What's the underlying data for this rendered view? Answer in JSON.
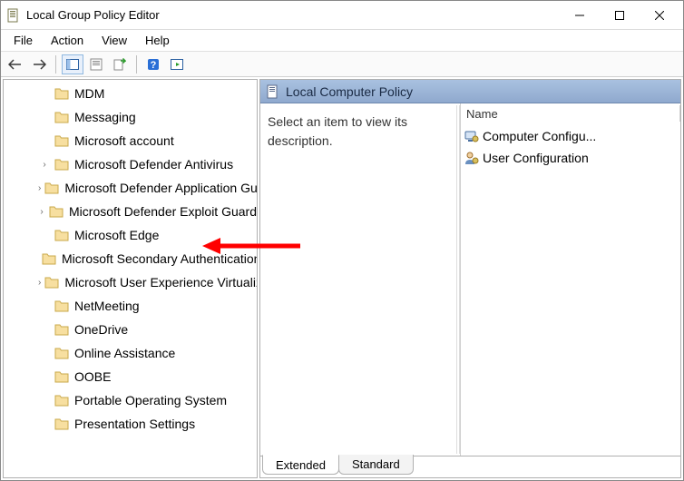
{
  "window": {
    "title": "Local Group Policy Editor",
    "icon": "policy-doc-icon"
  },
  "menubar": [
    "File",
    "Action",
    "View",
    "Help"
  ],
  "tree": {
    "items": [
      {
        "label": "MDM",
        "expandable": false
      },
      {
        "label": "Messaging",
        "expandable": false
      },
      {
        "label": "Microsoft account",
        "expandable": false
      },
      {
        "label": "Microsoft Defender Antivirus",
        "expandable": true
      },
      {
        "label": "Microsoft Defender Application Guard",
        "expandable": true
      },
      {
        "label": "Microsoft Defender Exploit Guard",
        "expandable": true
      },
      {
        "label": "Microsoft Edge",
        "expandable": false,
        "highlighted": true
      },
      {
        "label": "Microsoft Secondary Authentication Factor",
        "expandable": false
      },
      {
        "label": "Microsoft User Experience Virtualization",
        "expandable": true
      },
      {
        "label": "NetMeeting",
        "expandable": false
      },
      {
        "label": "OneDrive",
        "expandable": false
      },
      {
        "label": "Online Assistance",
        "expandable": false
      },
      {
        "label": "OOBE",
        "expandable": false
      },
      {
        "label": "Portable Operating System",
        "expandable": false
      },
      {
        "label": "Presentation Settings",
        "expandable": false
      }
    ]
  },
  "rightPanel": {
    "headerTitle": "Local Computer Policy",
    "description": "Select an item to view its description.",
    "listHeader": "Name",
    "listItems": [
      {
        "label": "Computer Configu...",
        "icon": "computer-config-icon"
      },
      {
        "label": "User Configuration",
        "icon": "user-config-icon"
      }
    ]
  },
  "tabs": {
    "extended": "Extended",
    "standard": "Standard"
  }
}
